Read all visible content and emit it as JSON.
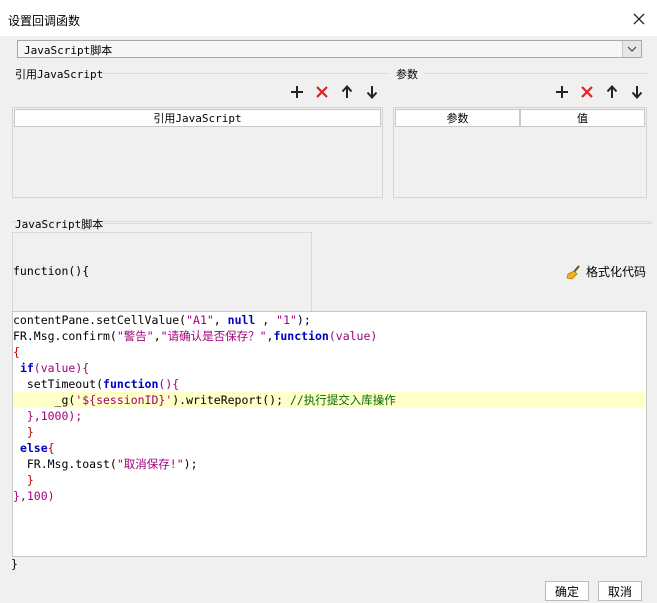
{
  "dialog": {
    "title": "设置回调函数",
    "close_icon": "close-icon"
  },
  "script_type": {
    "selected": "JavaScript脚本"
  },
  "ref_js": {
    "label": "引用JavaScript",
    "column_header": "引用JavaScript"
  },
  "params": {
    "label": "参数",
    "columns": [
      "参数",
      "值"
    ]
  },
  "toolbar_icons": [
    "add-icon",
    "delete-icon",
    "up-arrow-icon",
    "down-arrow-icon"
  ],
  "script": {
    "label": "JavaScript脚本",
    "function_header": "function(){",
    "format_label": "格式化代码",
    "closing_brace": "}",
    "code": {
      "l1_a": "contentPane.setCellValue(",
      "l1_b": "\"A1\"",
      "l1_c": ", ",
      "l1_d": "null",
      "l1_e": " , ",
      "l1_f": "\"1\"",
      "l1_g": ");",
      "l2_a": "FR.Msg.confirm(",
      "l2_b": "\"警告\"",
      "l2_c": ",",
      "l2_d": "\"请确认是否保存？\"",
      "l2_e": ",",
      "l2_f": "function",
      "l2_g": "(value)",
      "l3": "{",
      "l4_a": " ",
      "l4_b": "if",
      "l4_c": "(value){",
      "l5_a": "  setTimeout(",
      "l5_b": "function",
      "l5_c": "(){",
      "l6_a": "      _g(",
      "l6_b": "'${sessionID}'",
      "l6_c": ").writeReport(); ",
      "l6_d": "//执行提交入库操作",
      "l7": "  },1000);",
      "l8": "  }",
      "l9_a": " ",
      "l9_b": "else",
      "l9_c": "{",
      "l10_a": "  FR.Msg.toast(",
      "l10_b": "\"取消保存!\"",
      "l10_c": ");",
      "l11": "  }",
      "l12": "},100)"
    }
  },
  "buttons": {
    "ok": "确定",
    "cancel": "取消"
  },
  "colors": {
    "keyword": "#0000c0",
    "string": "#a0007a",
    "comment": "#006a00",
    "highlight_line": "#ffffc8"
  }
}
